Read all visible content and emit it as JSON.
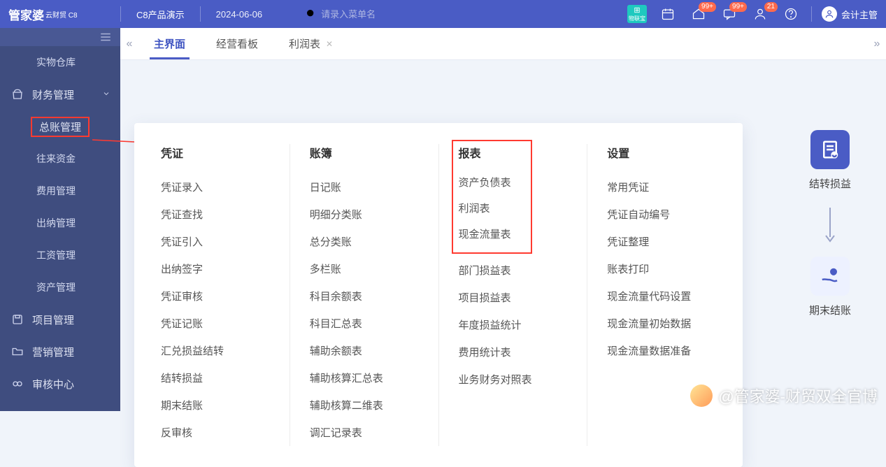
{
  "header": {
    "brand_main": "管家婆",
    "brand_sub": "云财贸 C8",
    "product": "C8产品演示",
    "date": "2024-06-06",
    "search_placeholder": "请录入菜单名",
    "badge1": "99+",
    "badge2": "99+",
    "badge3": "21",
    "teal_label": "物联宝",
    "user": "会计主管"
  },
  "sidebar": {
    "items": [
      {
        "label": "实物仓库"
      },
      {
        "label": "财务管理"
      },
      {
        "label": "总账管理"
      },
      {
        "label": "往来资金"
      },
      {
        "label": "费用管理"
      },
      {
        "label": "出纳管理"
      },
      {
        "label": "工资管理"
      },
      {
        "label": "资产管理"
      },
      {
        "label": "项目管理"
      },
      {
        "label": "营销管理"
      },
      {
        "label": "审核中心"
      }
    ]
  },
  "tabs": {
    "t0": "主界面",
    "t1": "经营看板",
    "t2": "利润表"
  },
  "panel": {
    "col1": {
      "title": "凭证",
      "items": [
        "凭证录入",
        "凭证查找",
        "凭证引入",
        "出纳签字",
        "凭证审核",
        "凭证记账",
        "汇兑损益结转",
        "结转损益",
        "期末结账",
        "反审核"
      ]
    },
    "col2": {
      "title": "账簿",
      "items": [
        "日记账",
        "明细分类账",
        "总分类账",
        "多栏账",
        "科目余额表",
        "科目汇总表",
        "辅助余额表",
        "辅助核算汇总表",
        "辅助核算二维表",
        "调汇记录表"
      ]
    },
    "col3": {
      "title": "报表",
      "boxed": [
        "资产负债表",
        "利润表",
        "现金流量表"
      ],
      "rest": [
        "部门损益表",
        "项目损益表",
        "年度损益统计",
        "费用统计表",
        "业务财务对照表"
      ]
    },
    "col4": {
      "title": "设置",
      "items": [
        "常用凭证",
        "凭证自动编号",
        "凭证整理",
        "账表打印",
        "现金流量代码设置",
        "现金流量初始数据",
        "现金流量数据准备"
      ]
    }
  },
  "right": {
    "label1": "结转损益",
    "label2": "期末结账"
  },
  "watermark": "@管家婆-财贸双全官博"
}
